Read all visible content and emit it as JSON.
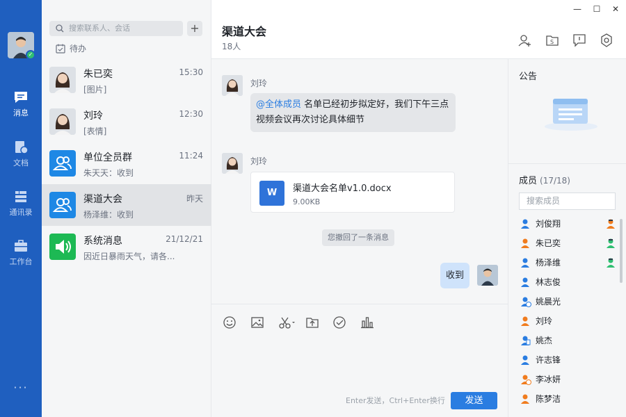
{
  "nav": {
    "items": [
      {
        "label": "消息"
      },
      {
        "label": "文档"
      },
      {
        "label": "通讯录"
      },
      {
        "label": "工作台"
      }
    ],
    "more": "···"
  },
  "list": {
    "search_placeholder": "搜索联系人、会话",
    "add": "+",
    "todo": "待办",
    "conversations": [
      {
        "name": "朱已奕",
        "time": "15:30",
        "msg": "[图片]"
      },
      {
        "name": "刘玲",
        "time": "12:30",
        "msg": "[表情]"
      },
      {
        "name": "单位全员群",
        "time": "11:24",
        "msg": "朱天天：收到"
      },
      {
        "name": "渠道大会",
        "time": "昨天",
        "msg": "杨泽维：收到"
      },
      {
        "name": "系统消息",
        "time": "21/12/21",
        "msg": "因近日暴雨天气，请各..."
      }
    ]
  },
  "chat": {
    "title": "渠道大会",
    "count": "18人",
    "window": {
      "min": "—",
      "max": "☐",
      "close": "✕"
    },
    "messages": [
      {
        "sender": "刘玲",
        "mention": "@全体成员",
        "text_line1": " 名单已经初步拟定好，我们下午三点",
        "text_line2": "视频会议再次讨论具体细节"
      },
      {
        "sender": "刘玲",
        "file_name": "渠道大会名单v1.0.docx",
        "file_size": "9.00KB",
        "file_icon": "W"
      }
    ],
    "recall": "您撤回了一条消息",
    "my_message": "收到"
  },
  "composer": {
    "hint": "Enter发送，Ctrl+Enter换行",
    "send": "发送"
  },
  "side": {
    "notice_title": "公告",
    "members_title": "成员",
    "members_count": "(17/18)",
    "members_search": "搜索成员",
    "members": [
      {
        "name": "刘俊翔",
        "color": "#2a7de1"
      },
      {
        "name": "朱已奕",
        "color": "#f07c1e"
      },
      {
        "name": "杨泽维",
        "color": "#2a7de1"
      },
      {
        "name": "林志俊",
        "color": "#2a7de1"
      },
      {
        "name": "姚晨光",
        "color": "#2a7de1"
      },
      {
        "name": "刘玲",
        "color": "#f07c1e"
      },
      {
        "name": "姚杰",
        "color": "#2a7de1"
      },
      {
        "name": "许志锋",
        "color": "#2a7de1"
      },
      {
        "name": "李冰妍",
        "color": "#f07c1e"
      },
      {
        "name": "陈梦洁",
        "color": "#f07c1e"
      }
    ]
  },
  "colors": {
    "accent": "#2a7de1",
    "nav": "#1f5fbf",
    "system": "#1db954"
  }
}
